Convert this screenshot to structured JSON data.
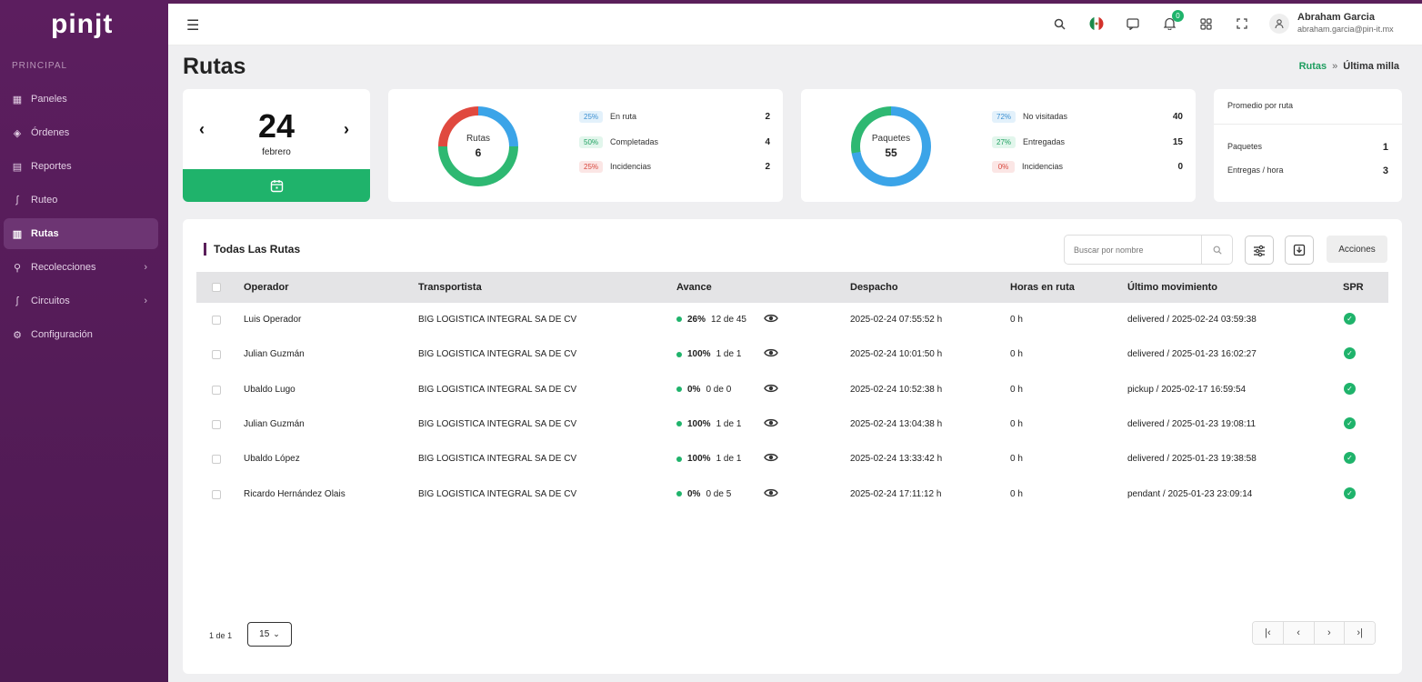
{
  "brand": {
    "logo": "pinjt"
  },
  "sidebar": {
    "section": "PRINCIPAL",
    "items": [
      {
        "label": "Paneles",
        "icon": "grid-icon"
      },
      {
        "label": "Órdenes",
        "icon": "box-icon"
      },
      {
        "label": "Reportes",
        "icon": "report-icon"
      },
      {
        "label": "Ruteo",
        "icon": "route-icon"
      },
      {
        "label": "Rutas",
        "icon": "map-icon",
        "active": true
      },
      {
        "label": "Recolecciones",
        "icon": "pickup-icon",
        "chevron": true
      },
      {
        "label": "Circuitos",
        "icon": "circuit-icon",
        "chevron": true
      },
      {
        "label": "Configuración",
        "icon": "gear-icon"
      }
    ]
  },
  "topbar": {
    "notifications_count": "0",
    "user_name": "Abraham Garcia",
    "user_email": "abraham.garcia@pin-it.mx"
  },
  "page": {
    "title": "Rutas",
    "breadcrumb": {
      "link": "Rutas",
      "separator": "»",
      "current": "Última milla"
    }
  },
  "date_card": {
    "day": "24",
    "month": "febrero"
  },
  "routes_card": {
    "label": "Rutas",
    "value": "6",
    "rows": [
      {
        "pct": "25%",
        "name": "En ruta",
        "value": "2",
        "color": "blue"
      },
      {
        "pct": "50%",
        "name": "Completadas",
        "value": "4",
        "color": "green"
      },
      {
        "pct": "25%",
        "name": "Incidencias",
        "value": "2",
        "color": "red"
      }
    ]
  },
  "packages_card": {
    "label": "Paquetes",
    "value": "55",
    "rows": [
      {
        "pct": "72%",
        "name": "No visitadas",
        "value": "40",
        "color": "blue"
      },
      {
        "pct": "27%",
        "name": "Entregadas",
        "value": "15",
        "color": "green"
      },
      {
        "pct": "0%",
        "name": "Incidencias",
        "value": "0",
        "color": "red"
      }
    ]
  },
  "average_card": {
    "title": "Promedio por ruta",
    "rows": [
      {
        "name": "Paquetes",
        "value": "1"
      },
      {
        "name": "Entregas / hora",
        "value": "3"
      }
    ]
  },
  "table": {
    "title": "Todas Las Rutas",
    "search_placeholder": "Buscar por nombre",
    "actions_label": "Acciones",
    "headers": {
      "operator": "Operador",
      "carrier": "Transportista",
      "progress": "Avance",
      "dispatch": "Despacho",
      "hours": "Horas en ruta",
      "last_move": "Último movimiento",
      "spr": "SPR"
    },
    "rows": [
      {
        "operator": "Luis Operador",
        "carrier": "BIG LOGISTICA INTEGRAL SA DE CV",
        "pct": "26%",
        "count": "12 de 45",
        "dispatch": "2025-02-24 07:55:52 h",
        "hours": "0 h",
        "last_move": "delivered / 2025-02-24 03:59:38"
      },
      {
        "operator": "Julian Guzmán",
        "carrier": "BIG LOGISTICA INTEGRAL SA DE CV",
        "pct": "100%",
        "count": "1 de 1",
        "dispatch": "2025-02-24 10:01:50 h",
        "hours": "0 h",
        "last_move": "delivered / 2025-01-23 16:02:27"
      },
      {
        "operator": "Ubaldo Lugo",
        "carrier": "BIG LOGISTICA INTEGRAL SA DE CV",
        "pct": "0%",
        "count": "0 de 0",
        "dispatch": "2025-02-24 10:52:38 h",
        "hours": "0 h",
        "last_move": "pickup / 2025-02-17 16:59:54"
      },
      {
        "operator": "Julian Guzmán",
        "carrier": "BIG LOGISTICA INTEGRAL SA DE CV",
        "pct": "100%",
        "count": "1 de 1",
        "dispatch": "2025-02-24 13:04:38 h",
        "hours": "0 h",
        "last_move": "delivered / 2025-01-23 19:08:11"
      },
      {
        "operator": "Ubaldo López",
        "carrier": "BIG LOGISTICA INTEGRAL SA DE CV",
        "pct": "100%",
        "count": "1 de 1",
        "dispatch": "2025-02-24 13:33:42 h",
        "hours": "0 h",
        "last_move": "delivered / 2025-01-23 19:38:58"
      },
      {
        "operator": "Ricardo Hernández Olais",
        "carrier": "BIG LOGISTICA INTEGRAL SA DE CV",
        "pct": "0%",
        "count": "0 de 5",
        "dispatch": "2025-02-24 17:11:12 h",
        "hours": "0 h",
        "last_move": "pendant / 2025-01-23 23:09:14"
      }
    ]
  },
  "pagination": {
    "page": "1",
    "of": "de",
    "total": "1",
    "page_size": "15"
  },
  "colors": {
    "sidebar": "#5c1e5f",
    "accent": "#1fb36b",
    "blue": "#3ba4e8",
    "green": "#2eb872",
    "red": "#e0493f"
  }
}
